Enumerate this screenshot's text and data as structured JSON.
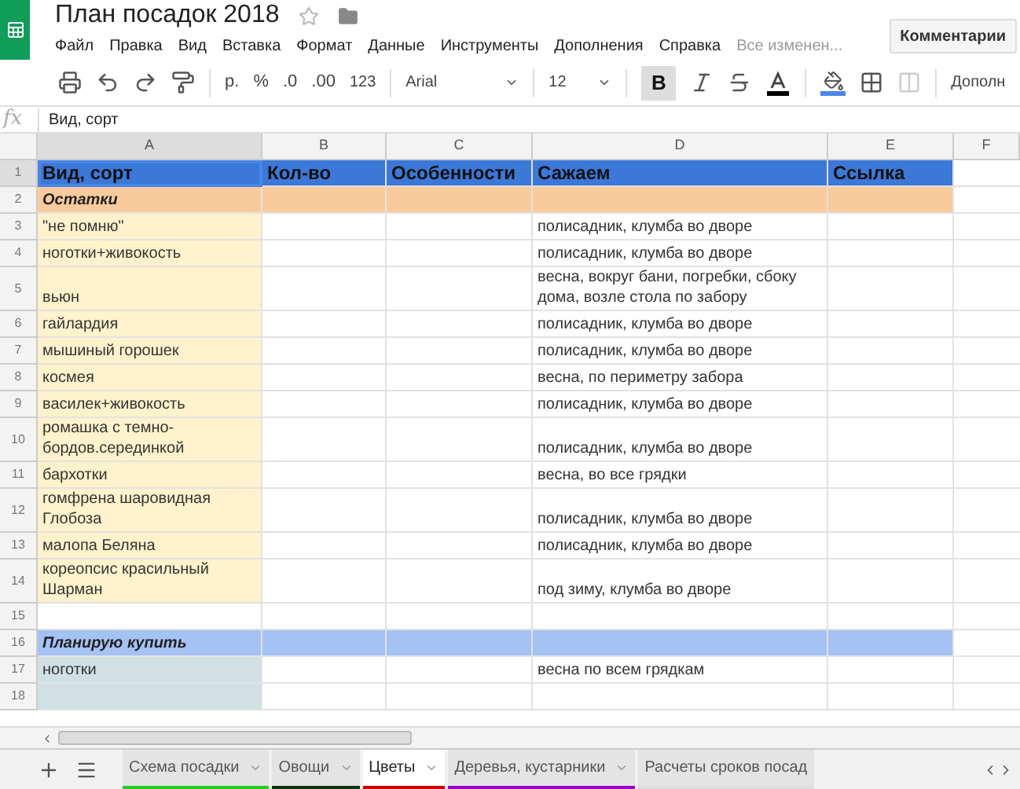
{
  "doc": {
    "title": "План посадок 2018",
    "status": "Все изменен...",
    "comments_button": "Комментарии"
  },
  "menu": [
    "Файл",
    "Правка",
    "Вид",
    "Вставка",
    "Формат",
    "Данные",
    "Инструменты",
    "Дополнения",
    "Справка"
  ],
  "toolbar": {
    "currency": "р.",
    "percent": "%",
    "dec_less": ".0",
    "dec_more": ".00",
    "number_format": "123",
    "font": "Arial",
    "size": "12",
    "bold": "B",
    "bold_on": true,
    "more": "Дополн"
  },
  "formula_bar": {
    "fx": "fx",
    "value": "Вид, сорт"
  },
  "columns": [
    {
      "label": "A",
      "selected": true
    },
    {
      "label": "B",
      "selected": false
    },
    {
      "label": "C",
      "selected": false
    },
    {
      "label": "D",
      "selected": false
    },
    {
      "label": "E",
      "selected": false
    },
    {
      "label": "F",
      "selected": false
    }
  ],
  "rows": [
    {
      "number": "1",
      "kind": "header",
      "selected": true,
      "cells": [
        "Вид, сорт",
        "Кол-во",
        "Особенности",
        "Сажаем",
        "Ссылка"
      ]
    },
    {
      "number": "2",
      "kind": "section",
      "selected": false,
      "cells": [
        "Остатки",
        "",
        "",
        "",
        ""
      ]
    },
    {
      "number": "3",
      "kind": "stock",
      "selected": false,
      "cells": [
        "\"не помню\"",
        "",
        "",
        "полисадник, клумба во дворе",
        ""
      ]
    },
    {
      "number": "4",
      "kind": "stock",
      "selected": false,
      "cells": [
        "ноготки+живокость",
        "",
        "",
        "полисадник, клумба во дворе",
        ""
      ]
    },
    {
      "number": "5",
      "kind": "stock",
      "selected": false,
      "cells": [
        "вьюн",
        "",
        "",
        "весна, вокруг бани, погребки, сбоку дома, возле стола по забору",
        ""
      ]
    },
    {
      "number": "6",
      "kind": "stock",
      "selected": false,
      "cells": [
        "гайлардия",
        "",
        "",
        "полисадник, клумба во дворе",
        ""
      ]
    },
    {
      "number": "7",
      "kind": "stock",
      "selected": false,
      "cells": [
        "мышиный горошек",
        "",
        "",
        "полисадник, клумба во дворе",
        ""
      ]
    },
    {
      "number": "8",
      "kind": "stock",
      "selected": false,
      "cells": [
        "космея",
        "",
        "",
        "весна, по периметру забора",
        ""
      ]
    },
    {
      "number": "9",
      "kind": "stock",
      "selected": false,
      "cells": [
        "василек+живокость",
        "",
        "",
        "полисадник, клумба во дворе",
        ""
      ]
    },
    {
      "number": "10",
      "kind": "stock",
      "selected": false,
      "cells": [
        "ромашка с темно-бордов.серединкой",
        "",
        "",
        "полисадник, клумба во дворе",
        ""
      ]
    },
    {
      "number": "11",
      "kind": "stock",
      "selected": false,
      "cells": [
        "бархотки",
        "",
        "",
        "весна, во все грядки",
        ""
      ]
    },
    {
      "number": "12",
      "kind": "stock",
      "selected": false,
      "cells": [
        "гомфрена шаровидная Глобоза",
        "",
        "",
        "полисадник, клумба во дворе",
        ""
      ]
    },
    {
      "number": "13",
      "kind": "stock",
      "selected": false,
      "cells": [
        "малопа Беляна",
        "",
        "",
        "полисадник, клумба во дворе",
        ""
      ]
    },
    {
      "number": "14",
      "kind": "stock",
      "selected": false,
      "cells": [
        "кореопсис красильный Шарман",
        "",
        "",
        "под зиму, клумба во дворе",
        ""
      ]
    },
    {
      "number": "15",
      "kind": "blank",
      "selected": false,
      "cells": [
        "",
        "",
        "",
        "",
        ""
      ]
    },
    {
      "number": "16",
      "kind": "plan_section",
      "selected": false,
      "cells": [
        "Планирую купить",
        "",
        "",
        "",
        ""
      ]
    },
    {
      "number": "17",
      "kind": "plan",
      "selected": false,
      "cells": [
        "ноготки",
        "",
        "",
        "весна по всем грядкам",
        ""
      ]
    },
    {
      "number": "18",
      "kind": "plan",
      "selected": false,
      "cells": [
        "",
        "",
        "",
        "",
        ""
      ]
    }
  ],
  "sheet_tabs": [
    {
      "label": "Схема посадки",
      "color": "#22cc22",
      "selected": false
    },
    {
      "label": "Овощи",
      "color": "#113311",
      "selected": false
    },
    {
      "label": "Цветы",
      "color": "#cc0000",
      "selected": true
    },
    {
      "label": "Деревья, кустарники",
      "color": "#9900cc",
      "selected": false
    },
    {
      "label": "Расчеты сроков посад",
      "color": "#dddddd",
      "selected": false
    }
  ]
}
